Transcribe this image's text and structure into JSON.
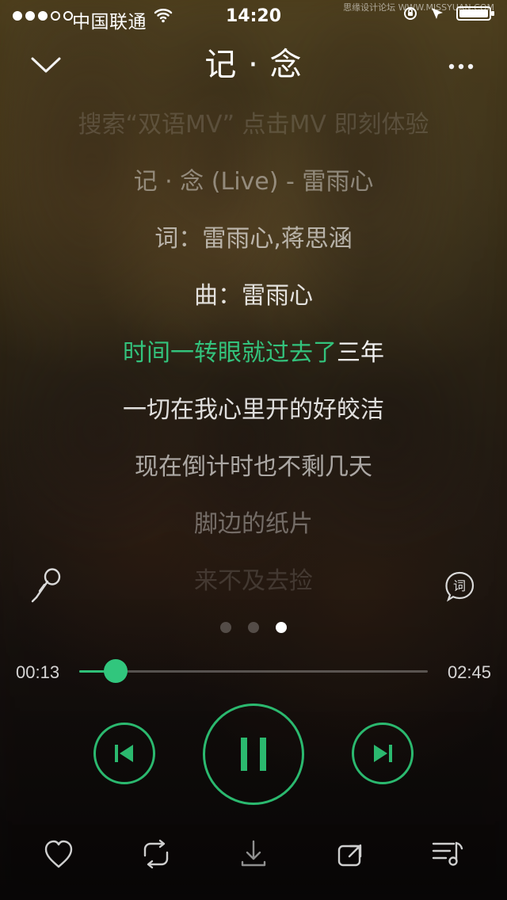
{
  "status_bar": {
    "carrier": "中国联通",
    "time": "14:20"
  },
  "watermark": {
    "text": "思缘设计论坛 WWW.MISSYUAN.COM"
  },
  "header": {
    "title": "记 · 念"
  },
  "lyrics": [
    {
      "text": "搜索“双语MV” 点击MV 即刻体验"
    },
    {
      "text": "记 · 念 (Live) - 雷雨心"
    },
    {
      "text": "词：雷雨心,蒋思涵"
    },
    {
      "text": "曲：雷雨心"
    },
    {
      "segments": [
        {
          "text": "时间一转眼就过去了"
        },
        {
          "text": "三年"
        }
      ]
    },
    {
      "text": "一切在我心里开的好皎洁"
    },
    {
      "text": "现在倒计时也不剩几天"
    },
    {
      "text": "脚边的纸片"
    },
    {
      "text": "来不及去捡"
    }
  ],
  "player": {
    "current_time": "00:13",
    "total_time": "02:45",
    "progress": 0.105,
    "page_index": 3,
    "page_count": 3
  },
  "icons": {
    "back": "chevron-down-icon",
    "more": "more-icon",
    "mic": "microphone-icon",
    "lyric": "lyric-bubble-icon",
    "prev": "previous-track-icon",
    "play": "pause-icon",
    "next": "next-track-icon",
    "favorite": "heart-icon",
    "repeat": "repeat-icon",
    "download": "download-icon",
    "share": "share-icon",
    "queue": "queue-music-icon"
  },
  "colors": {
    "accent": "#2fc078",
    "text": "#ffffff"
  }
}
